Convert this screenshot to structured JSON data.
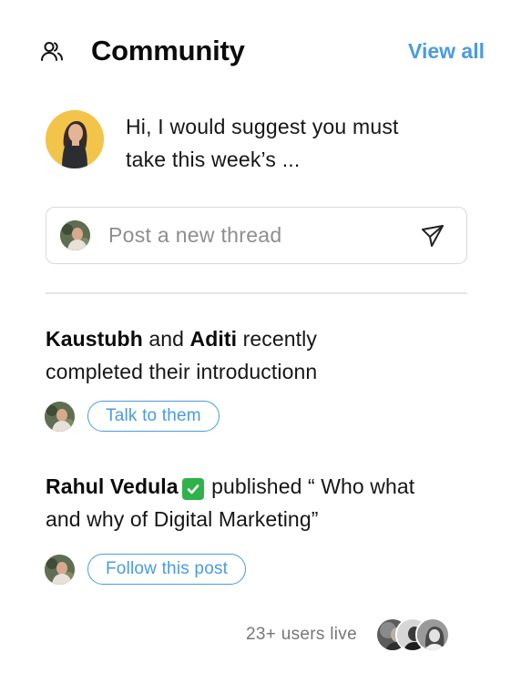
{
  "header": {
    "title": "Community",
    "view_all": "View all",
    "icon": "users-icon"
  },
  "message": {
    "text_line1": "Hi, I would suggest you must",
    "text_line2": "take this week’s ..."
  },
  "composer": {
    "placeholder": "Post a new thread",
    "send_icon": "send-icon"
  },
  "activities": [
    {
      "name1": "Kaustubh",
      "connector": " and ",
      "name2": "Aditi",
      "text_after": " recently",
      "text_line2": "completed their introductionn",
      "action": "Talk to them"
    },
    {
      "name": "Rahul Vedula",
      "text_after": " published “ Who what",
      "text_line2": "and why of Digital Marketing”",
      "action": "Follow this post"
    }
  ],
  "live": {
    "text": "23+ users live"
  },
  "colors": {
    "accent": "#4a9be0",
    "text": "#161616",
    "muted": "#8e8e8e",
    "border": "#d9d9d9",
    "verified": "#2fb24a"
  }
}
